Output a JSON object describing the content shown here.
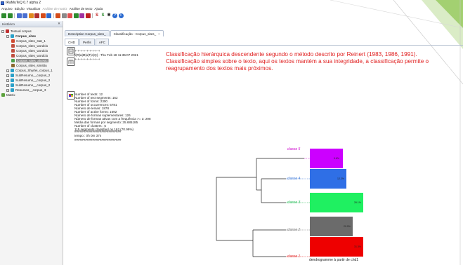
{
  "window": {
    "title": "IRaMuTeQ 0.7 alpha 2"
  },
  "menubar": {
    "items": [
      {
        "label": "Arquivo",
        "enabled": true
      },
      {
        "label": "Edição",
        "enabled": true
      },
      {
        "label": "Visualizar",
        "enabled": true
      },
      {
        "label": "Análise de matriz",
        "enabled": false
      },
      {
        "label": "Análise de texto",
        "enabled": true
      },
      {
        "label": "Ajuda",
        "enabled": true
      }
    ]
  },
  "toolbar": {
    "buttons": [
      {
        "name": "open-corpus-icon",
        "color": "#2e8b2e"
      },
      {
        "name": "open-matrix-icon",
        "color": "#2e8b2e"
      },
      {
        "name": "text-icon",
        "color": "#4a6fd0"
      },
      {
        "name": "table-icon",
        "color": "#4a6fd0"
      },
      {
        "name": "settings-icon",
        "color": "#e08a1e"
      },
      {
        "name": "stats-icon",
        "color": "#b03030"
      },
      {
        "name": "specificities-icon",
        "color": "#d44c1a"
      },
      {
        "name": "chd-icon",
        "color": "#2a6ad0"
      },
      {
        "name": "home-icon",
        "color": "#d44c1a"
      },
      {
        "name": "matrix-icon",
        "color": "#8a8a8a"
      },
      {
        "name": "wordcloud-icon",
        "color": "#e05050"
      },
      {
        "name": "similitude-icon",
        "color": "#2e8b2e"
      },
      {
        "name": "prototype-icon",
        "color": "#a030a0"
      },
      {
        "name": "labbe-icon",
        "color": "#c02020"
      },
      {
        "name": "s-icon-1",
        "color": "#c02020",
        "glyph": "S"
      },
      {
        "name": "s-icon-2",
        "color": "#2e8b2e",
        "glyph": "S"
      },
      {
        "name": "star-icon",
        "color": "#222222",
        "glyph": "✱"
      },
      {
        "name": "help-icon",
        "color": "#2a6ad0",
        "glyph": "?"
      },
      {
        "name": "info-icon",
        "color": "#2a6ad0",
        "glyph": "i"
      }
    ]
  },
  "left_panel": {
    "title": "Histórico",
    "tree": [
      {
        "label": "Textual corpus",
        "level": 0,
        "icon": "root-icon",
        "icon_color": "#c03030",
        "expand": "-"
      },
      {
        "label": "Corpus_sites",
        "level": 1,
        "icon": "corpus-icon",
        "icon_color": "#2aa0c8",
        "expand": "-",
        "bold": true
      },
      {
        "label": "Corpus_sites_stat_1",
        "level": 2,
        "icon": "stat-icon",
        "icon_color": "#d04a30"
      },
      {
        "label": "Corpus_sites_wordclo",
        "level": 2,
        "icon": "wordcloud-icon",
        "icon_color": "#c05040"
      },
      {
        "label": "Corpus_sites_wordclo",
        "level": 2,
        "icon": "wordcloud-icon",
        "icon_color": "#c05040"
      },
      {
        "label": "Corpus_sites_wordclo",
        "level": 2,
        "icon": "wordcloud-icon",
        "icon_color": "#c05040"
      },
      {
        "label": "Corpus_sites_alcestc",
        "level": 2,
        "icon": "chd-icon",
        "icon_color": "#4aa04a",
        "selected": true
      },
      {
        "label": "Corpus_sites_simititu",
        "level": 2,
        "icon": "similitude-icon",
        "icon_color": "#8a6a30"
      },
      {
        "label": "Corpus_Shyrlei_corpus_1",
        "level": 1,
        "icon": "corpus-icon",
        "icon_color": "#2aa0c8",
        "expand": "+"
      },
      {
        "label": "SubResumo__corpus_2",
        "level": 1,
        "icon": "corpus-icon",
        "icon_color": "#2aa0c8",
        "expand": "+"
      },
      {
        "label": "SubResumo__corpus_2",
        "level": 1,
        "icon": "corpus-icon",
        "icon_color": "#2aa0c8",
        "expand": "+"
      },
      {
        "label": "SubResumo__corpus_2",
        "level": 1,
        "icon": "corpus-icon",
        "icon_color": "#2aa0c8",
        "expand": "+"
      },
      {
        "label": "Resumos__corpus_3",
        "level": 1,
        "icon": "corpus-icon",
        "icon_color": "#2aa0c8",
        "expand": "+"
      },
      {
        "label": "Matrix",
        "level": 0,
        "icon": "matrix-icon",
        "icon_color": "#5aa03a"
      }
    ]
  },
  "tabs": [
    {
      "label": "Description Corpus_sites_",
      "active": false,
      "closable": false
    },
    {
      "label": "Classificação - Corpus_sites_",
      "active": true,
      "closable": true
    }
  ],
  "subtabs": [
    {
      "label": "CHD",
      "active": true
    },
    {
      "label": "Perfis",
      "active": false
    },
    {
      "label": "AFC",
      "active": false
    }
  ],
  "stats_log": {
    "header_line1": "+-+-+-+-+-+-+-+-+",
    "header_line2": "|i|R|a|M|u|T|e|Q| - Thu Feb 18 11:35:07 2021",
    "header_line3": "+-+-+-+-+-+-+-+-+",
    "lines": [
      "Number of texts: 12",
      "Number of text segments: 162",
      "Number of forms: 2300",
      "Number of occurrences: 5781",
      "Número de lemas: 1878",
      "Number of active forms: 1692",
      "Número de formas suplementares: 126",
      "Número de formas ativas com a frequência >= 3: 298",
      "Média das formas por segmento: 35.685185",
      "Number of clusters : 5",
      "115 segments classified on 162 (70.99%)"
    ],
    "separator": "##########################",
    "time": "tempo : 0h 0m 37s"
  },
  "description_text": [
    "Classificação hierárquica descendente segundo o método descrito por Reinert (1983, 1986, 1991).",
    "Classificação simples sobre o texto, aqui os textos mantém a sua integridade, a classificação permite o",
    "reagrupamento dos textos mais próximos."
  ],
  "dendrogram": {
    "caption": "dendrogramme à partir de chd1",
    "classes": [
      {
        "label": "classe 5",
        "color": "#cc00cc",
        "bar_color": "#cc00ff",
        "pct": "9.6%",
        "width_frac": 0.62
      },
      {
        "label": "classe 4",
        "color": "#3c78d8",
        "bar_color": "#2f6fe6",
        "pct": "12.2%",
        "width_frac": 0.68
      },
      {
        "label": "classe 3",
        "color": "#22bb55",
        "bar_color": "#1ff061",
        "pct": "26.1%",
        "width_frac": 1.0
      },
      {
        "label": "classe 2",
        "color": "#777777",
        "bar_color": "#6b6b6b",
        "pct": "20.9%",
        "width_frac": 0.8
      },
      {
        "label": "classe 1",
        "color": "#e02020",
        "bar_color": "#ee0000",
        "pct": "31.3%",
        "width_frac": 1.0
      }
    ]
  }
}
